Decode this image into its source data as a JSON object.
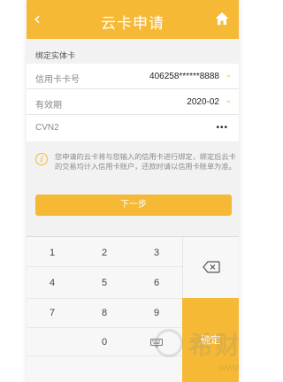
{
  "header": {
    "title": "云卡申请",
    "back_icon": "chevron-left-icon",
    "home_icon": "home-icon",
    "color": "#f6b935"
  },
  "section_label": "绑定实体卡",
  "form": {
    "rows": [
      {
        "label": "信用卡卡号",
        "value": "406258******8888",
        "chevron": "⌄"
      },
      {
        "label": "有效期",
        "value": "2020-02",
        "chevron": "⌄"
      },
      {
        "label": "CVN2",
        "value": "•••"
      }
    ]
  },
  "notice": {
    "icon": "info-icon",
    "icon_glyph": "i",
    "text": "您申请的云卡将与您输入的信用卡进行绑定，绑定后云卡的交易均计入信用卡账户，还款时请以信用卡账单为准。"
  },
  "next_button": "下一步",
  "keypad": {
    "keys": [
      "1",
      "2",
      "3",
      "4",
      "5",
      "6",
      "7",
      "8",
      "9",
      "0"
    ],
    "delete_icon": "backspace-icon",
    "hide_icon": "keyboard-hide-icon",
    "confirm": "确定"
  },
  "watermark": {
    "text": "希财",
    "url": "www.csai.cn"
  }
}
